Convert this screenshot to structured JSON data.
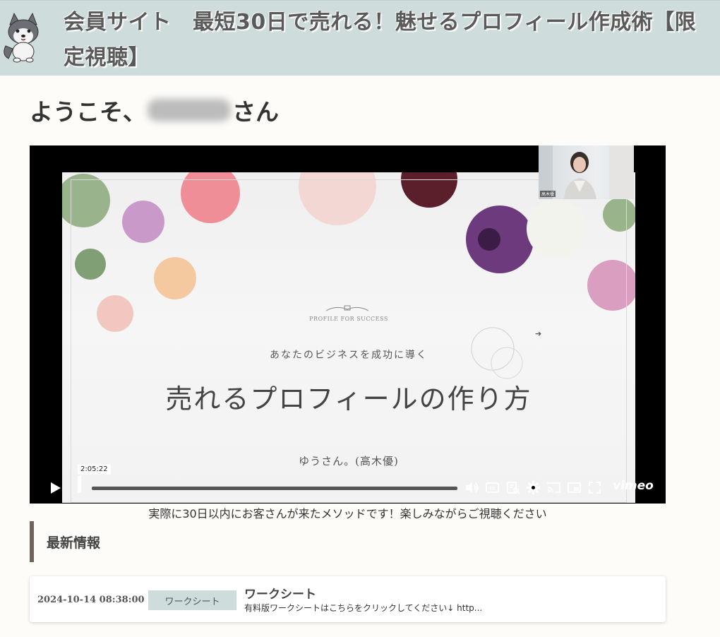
{
  "header": {
    "title": "会員サイト　最短30日で売れる！魅せるプロフィール作成術【限定視聴】"
  },
  "welcome": {
    "prefix": "ようこそ、",
    "suffix": "さん"
  },
  "video": {
    "slide": {
      "tagline": "PROFILE FOR SUCCESS",
      "lead": "あなたのビジネスを成功に導く",
      "title": "売れるプロフィールの作り方",
      "author": "ゆうさん。(高木優)"
    },
    "pip_label": "高木優",
    "time_tooltip": "2:05:22",
    "progress": 0.0,
    "brand": "vimeo",
    "icons": [
      "play-icon",
      "volume-icon",
      "cc-icon",
      "transcript-icon",
      "settings-icon",
      "cast-icon",
      "pip-icon",
      "fullscreen-icon"
    ]
  },
  "caption": "実際に30日以内にお客さんが来たメソッドです！楽しみながらご視聴ください",
  "news": {
    "section_title": "最新情報",
    "items": [
      {
        "date": "2024-10-14 08:38:00",
        "category": "ワークシート",
        "title": "ワークシート",
        "excerpt": "有料版ワークシートはこちらをクリックしてください↓ http..."
      }
    ]
  },
  "colors": {
    "header_bg": "#cfdcdc",
    "page_bg": "#fdfcf8",
    "accent_bar": "#6f655c",
    "badge_bg": "#cfdcdc"
  }
}
